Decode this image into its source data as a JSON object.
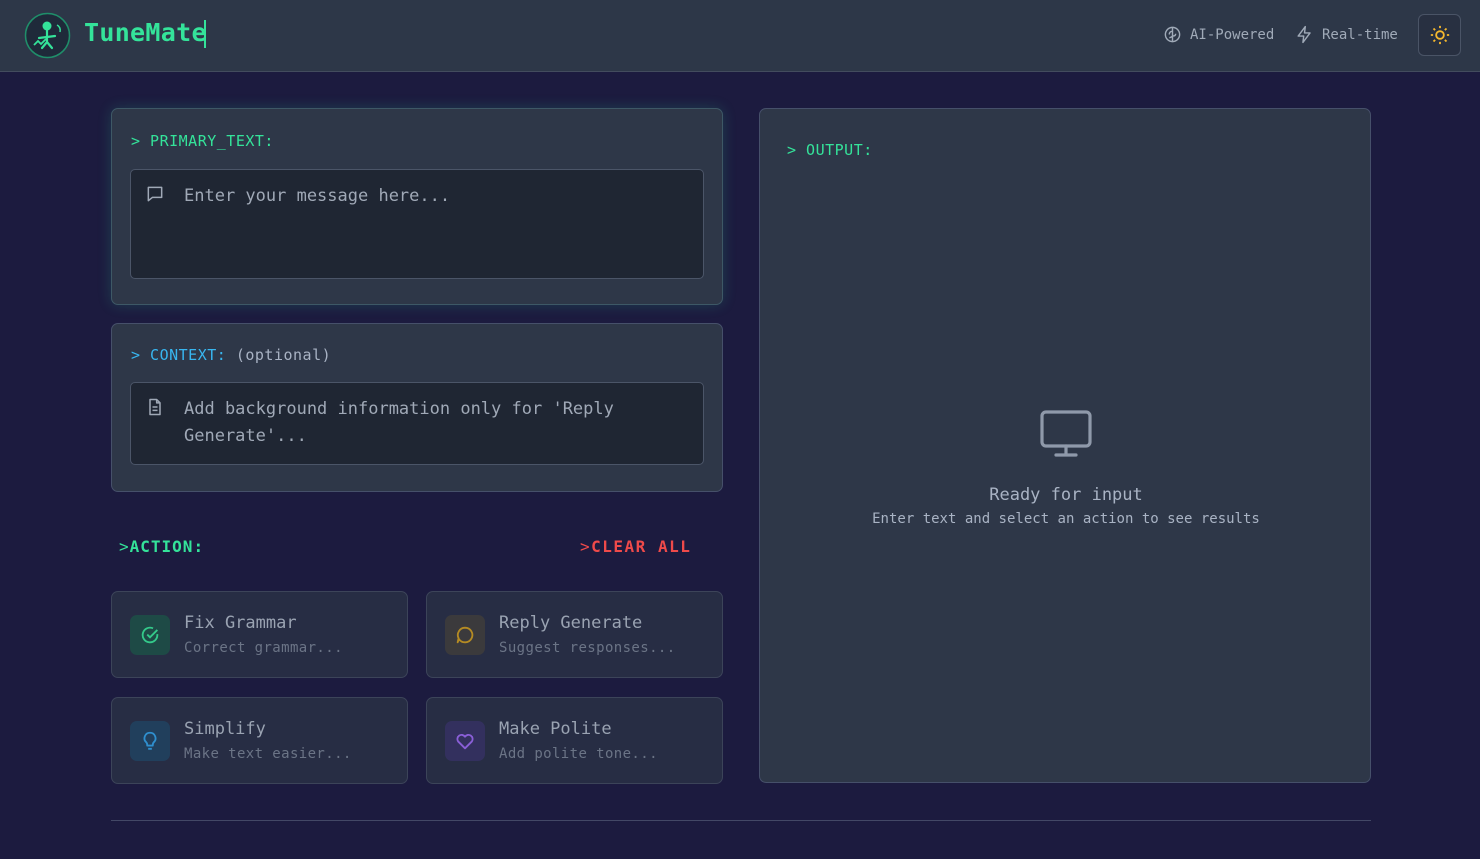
{
  "header": {
    "brand": "TuneMate",
    "badges": [
      {
        "label": "AI-Powered",
        "icon": "brain-icon"
      },
      {
        "label": "Real-time",
        "icon": "lightning-icon"
      }
    ],
    "theme_toggle_icon": "sun-icon"
  },
  "primary": {
    "label": "> PRIMARY_TEXT:",
    "placeholder": "Enter your message here...",
    "icon": "message-icon"
  },
  "context": {
    "label": "> CONTEXT:",
    "optional": "(optional)",
    "placeholder": "Add background information only for 'Reply Generate'...",
    "icon": "document-icon"
  },
  "action": {
    "label": "ACTION:",
    "clear_label": "CLEAR ALL",
    "items": [
      {
        "title": "Fix Grammar",
        "desc": "Correct grammar...",
        "icon": "check-circle-icon",
        "color": "#34e39a"
      },
      {
        "title": "Reply Generate",
        "desc": "Suggest responses...",
        "icon": "chat-bubble-icon",
        "color": "#d4a21c"
      },
      {
        "title": "Simplify",
        "desc": "Make text easier...",
        "icon": "lightbulb-icon",
        "color": "#38b6f0"
      },
      {
        "title": "Make Polite",
        "desc": "Add polite tone...",
        "icon": "heart-icon",
        "color": "#a06bf0"
      }
    ]
  },
  "output": {
    "label": "> OUTPUT:",
    "empty_title": "Ready for input",
    "empty_sub": "Enter text and select an action to see results",
    "icon": "monitor-icon"
  },
  "colors": {
    "accent_green": "#34e39a",
    "accent_blue": "#38b6f0",
    "danger": "#ef4a4a",
    "background": "#1c1b3f"
  }
}
